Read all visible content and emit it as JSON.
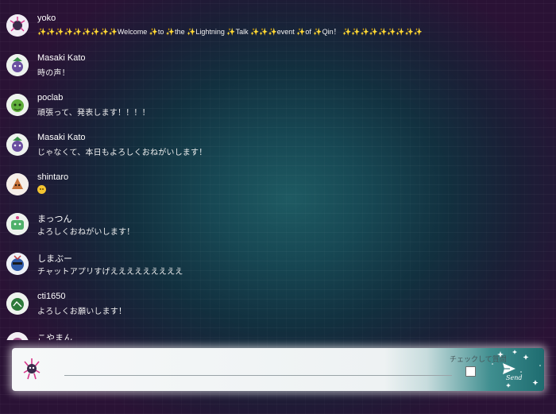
{
  "messages": [
    {
      "name": "yoko",
      "text": "✨✨✨✨✨✨✨✨✨Welcome ✨to ✨the ✨Lightning ✨Talk ✨✨✨event ✨of ✨Qin！ ✨✨✨✨✨✨✨✨✨",
      "avatar": "yoko-avatar"
    },
    {
      "name": "Masaki Kato",
      "text": "時の声！",
      "avatar": "masaki-avatar"
    },
    {
      "name": "poclab",
      "text": "頑張って、発表します！！！！",
      "avatar": "poclab-avatar"
    },
    {
      "name": "Masaki Kato",
      "text": "じゃなくて、本日もよろしくおねがいします！",
      "avatar": "masaki-avatar"
    },
    {
      "name": "shintaro",
      "text": "",
      "emoji": "smile-emoji",
      "avatar": "shintaro-avatar"
    },
    {
      "name": "まっつん",
      "text": "よろしくおねがいします！",
      "avatar": "mattsun-avatar"
    },
    {
      "name": "しまぶー",
      "text": "チャットアプリすげえええええええええ",
      "avatar": "shimabu-avatar"
    },
    {
      "name": "cti1650",
      "text": "よろしくお願いします！",
      "avatar": "cti1650-avatar"
    },
    {
      "name": "こやまん",
      "text": "",
      "avatar": "koyaman-avatar"
    }
  ],
  "composer": {
    "input_value": "",
    "input_placeholder": "",
    "checkbox_label": "チェックして質問",
    "checkbox_checked": false,
    "send_label": "Send",
    "send_icon": "paper-plane-icon",
    "user_avatar": "yoko-avatar"
  },
  "colors": {
    "background_center": "#1e5a62",
    "background_edge": "#2a1235",
    "text": "#ffffff",
    "composer_accent": "#1e6c70"
  }
}
